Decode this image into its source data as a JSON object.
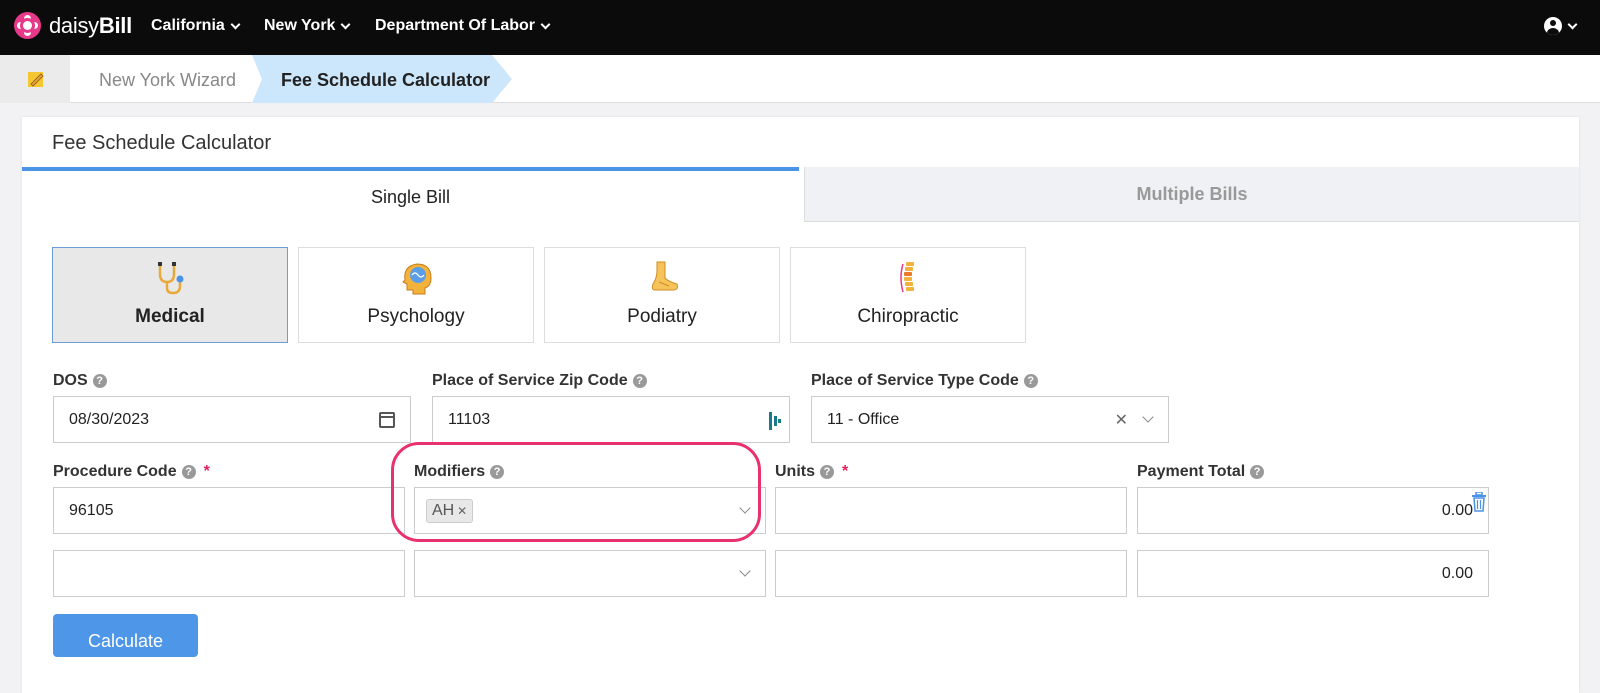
{
  "nav": {
    "logo_light": "daisy",
    "logo_bold": "Bill",
    "menus": [
      "California",
      "New York",
      "Department Of Labor"
    ]
  },
  "breadcrumb": {
    "items": [
      "New York Wizard",
      "Fee Schedule Calculator"
    ]
  },
  "card": {
    "title": "Fee Schedule Calculator",
    "tabs": [
      "Single Bill",
      "Multiple Bills"
    ],
    "active_tab": "Single Bill"
  },
  "specialties": [
    {
      "label": "Medical",
      "icon": "stethoscope-icon",
      "active": true
    },
    {
      "label": "Psychology",
      "icon": "brain-icon",
      "active": false
    },
    {
      "label": "Podiatry",
      "icon": "foot-icon",
      "active": false
    },
    {
      "label": "Chiropractic",
      "icon": "spine-icon",
      "active": false
    }
  ],
  "form": {
    "dos_label": "DOS",
    "dos_value": "08/30/2023",
    "zip_label": "Place of Service Zip Code",
    "zip_value": "11103",
    "pos_type_label": "Place of Service Type Code",
    "pos_type_value": "11 - Office",
    "procedure_label": "Procedure Code",
    "modifiers_label": "Modifiers",
    "units_label": "Units",
    "payment_label": "Payment Total",
    "required_mark": "*",
    "help_mark": "?",
    "rows": [
      {
        "procedure": "96105",
        "modifier_tag": "AH",
        "units": "",
        "payment": "0.00"
      },
      {
        "procedure": "",
        "modifier_tag": "",
        "units": "",
        "payment": "0.00"
      }
    ]
  },
  "actions": {
    "calculate_label": "Calculate"
  },
  "colors": {
    "accent": "#4b93e6",
    "highlight": "#e8326f",
    "brand": "#e8388a"
  }
}
